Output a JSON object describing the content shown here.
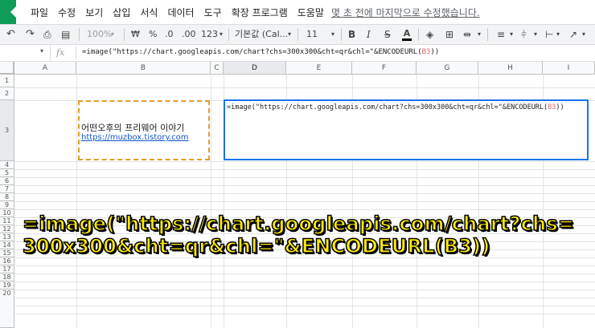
{
  "menubar": {
    "items": [
      "파일",
      "수정",
      "보기",
      "삽입",
      "서식",
      "데이터",
      "도구",
      "확장 프로그램",
      "도움말"
    ],
    "last_edit": "몇 초 전에 마지막으로 수정했습니다."
  },
  "toolbar": {
    "zoom": "100%",
    "currency": "₩",
    "percent": "%",
    "dec_decrease": ".0",
    "dec_increase": ".00",
    "format_more": "123",
    "font": "기본값 (Cal...",
    "font_size": "11",
    "bold": "B",
    "italic": "I",
    "strike": "S",
    "text_color": "A"
  },
  "formula_bar": {
    "fx": "fx",
    "prefix": "=image(\"https://chart.googleapis.com/chart?chs=300x300&cht=qr&chl=\"&ENCODEURL(",
    "ref": "B3",
    "suffix": "))"
  },
  "columns": [
    "A",
    "B",
    "C",
    "D",
    "E",
    "F",
    "G",
    "H",
    "I"
  ],
  "rows": [
    "1",
    "2",
    "3",
    "4",
    "5",
    "6",
    "7",
    "8",
    "9",
    "10",
    "11",
    "12",
    "13",
    "14",
    "15",
    "16",
    "17",
    "18",
    "19",
    "20"
  ],
  "cell_b3": {
    "text": "어떤오후의 프리웨어 이야기",
    "link": "https://muzbox.tistory.com"
  },
  "overlay": {
    "line1": "=image(\"https://chart.googleapis.com/chart?chs=",
    "line2": "300x300&cht=qr&chl=\"&ENCODEURL(B3))"
  },
  "colors": {
    "accent": "#1a73e8",
    "copy_border": "#e39c2d",
    "overlay_text": "#ffeb00",
    "brand": "#0f9d58"
  }
}
